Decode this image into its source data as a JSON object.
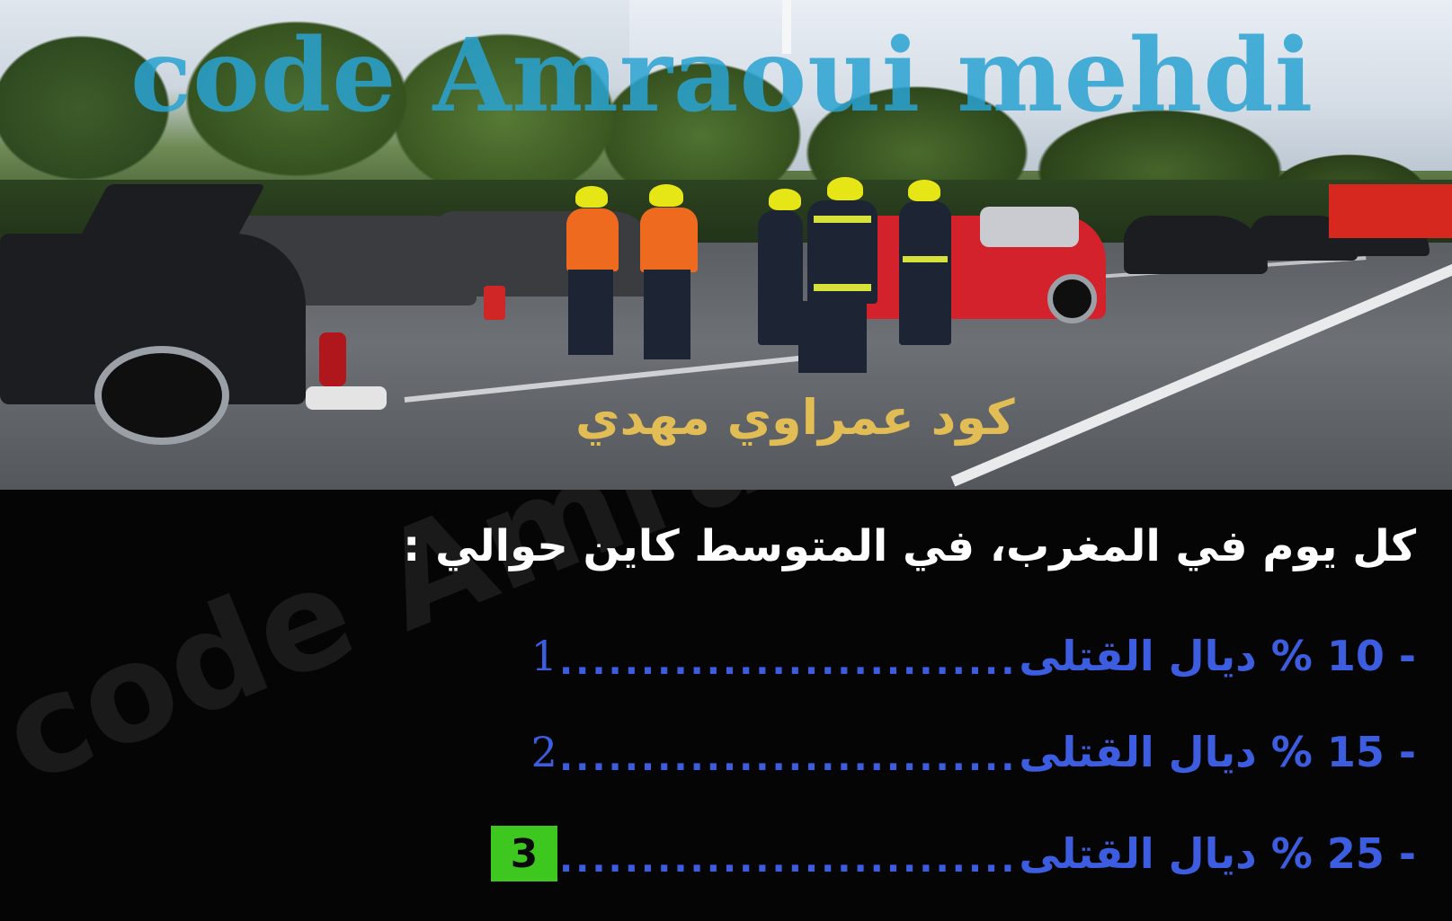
{
  "photo": {
    "watermark_latin": "code Amraoui mehdi",
    "watermark_arabic": "كود عمراوي مهدي"
  },
  "panel": {
    "background_watermark": "code Amraoui mehdi"
  },
  "question": {
    "text": "كل يوم في المغرب، في المتوسط كاين حوالي :"
  },
  "answers": [
    {
      "text": "- 10 % ديال القتلى",
      "dots": "............................",
      "number": "1",
      "selected": false
    },
    {
      "text": "- 15 % ديال القتلى",
      "dots": "............................",
      "number": "2",
      "selected": false
    },
    {
      "text": "- 25 % ديال القتلى",
      "dots": "............................",
      "number": "3",
      "selected": true
    }
  ],
  "colors": {
    "answer_text": "#3d5de0",
    "selected_badge": "#3ec81f",
    "watermark_latin": "#2aa3d2",
    "watermark_arabic": "#e2bd55",
    "question_text": "#ffffff"
  }
}
